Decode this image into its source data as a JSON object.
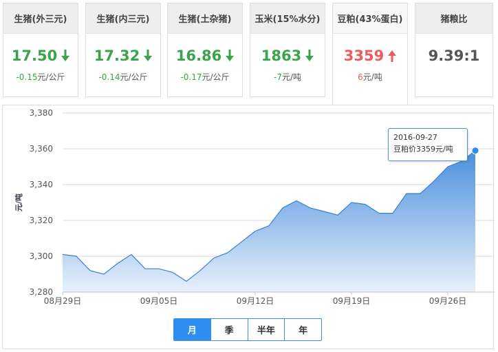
{
  "cards": [
    {
      "title": "生猪(外三元)",
      "price": "17.50",
      "change": "-0.15",
      "unit": "元/公斤",
      "direction": "down"
    },
    {
      "title": "生猪(内三元)",
      "price": "17.32",
      "change": "-0.14",
      "unit": "元/公斤",
      "direction": "down"
    },
    {
      "title": "生猪(土杂猪)",
      "price": "16.86",
      "change": "-0.17",
      "unit": "元/公斤",
      "direction": "down"
    },
    {
      "title": "玉米(15%水分)",
      "price": "1863",
      "change": "-7",
      "unit": "元/吨",
      "direction": "down"
    },
    {
      "title": "豆粕(43%蛋白)",
      "price": "3359",
      "change": "6",
      "unit": "元/吨",
      "direction": "up"
    },
    {
      "title": "猪粮比",
      "price": "9.39:1",
      "change": "",
      "unit": "",
      "direction": "none"
    }
  ],
  "colors": {
    "down": "#3aa34c",
    "up": "#ee5b5b",
    "accent": "#2e8df0",
    "area_top": "#4a8fdc",
    "area_bottom": "#e8f1fb",
    "line": "#3a7fcf"
  },
  "tooltip": {
    "date": "2016-09-27",
    "text": "豆粕价3359元/吨"
  },
  "range_buttons": [
    {
      "label": "月",
      "active": true
    },
    {
      "label": "季",
      "active": false
    },
    {
      "label": "半年",
      "active": false
    },
    {
      "label": "年",
      "active": false
    }
  ],
  "chart_data": {
    "type": "area",
    "ylabel": "元/吨",
    "ylim": [
      3280,
      3380
    ],
    "yticks": [
      "3,280",
      "3,300",
      "3,320",
      "3,340",
      "3,360",
      "3,380"
    ],
    "xtick_labels": [
      "08月29日",
      "09月05日",
      "09月12日",
      "09月19日",
      "09月26日"
    ],
    "xtick_positions": [
      0,
      7,
      14,
      21,
      28
    ],
    "grid": true,
    "series": [
      {
        "values": [
          3301,
          3300,
          3292,
          3290,
          3296,
          3301,
          3293,
          3293,
          3291,
          3286,
          3292,
          3299,
          3302,
          3308,
          3314,
          3317,
          3327,
          3331,
          3327,
          3325,
          3323,
          3330,
          3329,
          3324,
          3324,
          3335,
          3335,
          3342,
          3350,
          3353,
          3359
        ]
      }
    ]
  }
}
